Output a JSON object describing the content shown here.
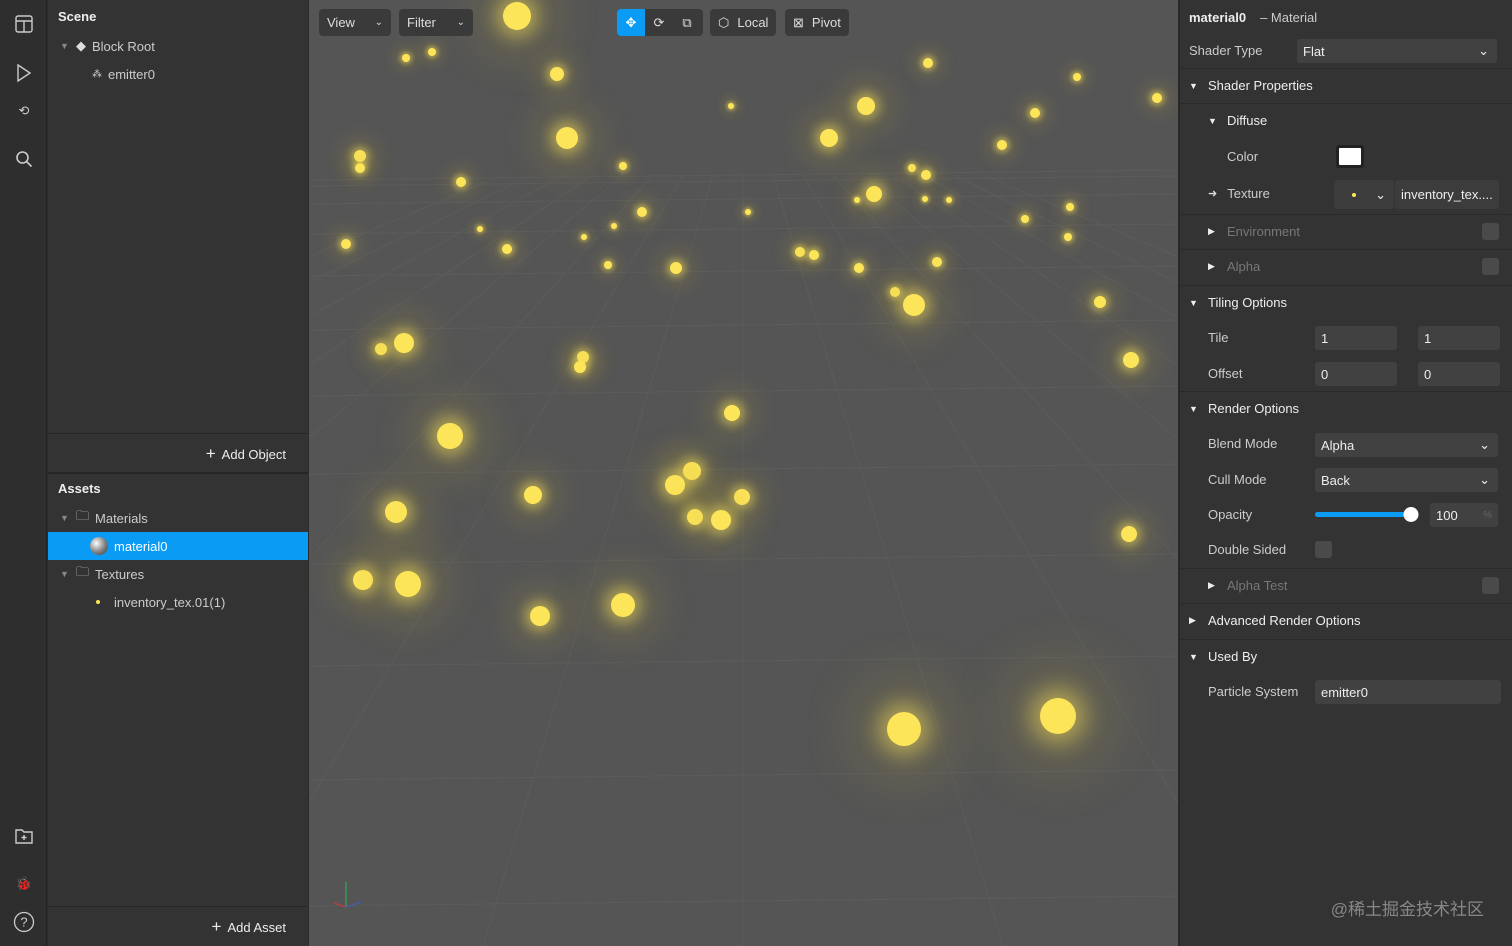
{
  "scene": {
    "title": "Scene",
    "items": [
      {
        "label": "Block Root"
      },
      {
        "label": "emitter0"
      }
    ],
    "add_label": "Add Object"
  },
  "assets": {
    "title": "Assets",
    "folders": [
      {
        "label": "Materials"
      },
      {
        "label": "material0"
      },
      {
        "label": "Textures"
      },
      {
        "label": "inventory_tex.01(1)"
      }
    ],
    "add_label": "Add Asset"
  },
  "toolbar": {
    "view": "View",
    "filter": "Filter",
    "local": "Local",
    "pivot": "Pivot"
  },
  "inspector": {
    "name": "material0",
    "type": "– Material",
    "shader_type_label": "Shader Type",
    "shader_type": "Flat",
    "shader_props": "Shader Properties",
    "diffuse": "Diffuse",
    "color_label": "Color",
    "color": "#ffffff",
    "texture_label": "Texture",
    "texture_value": "inventory_tex....",
    "environment": "Environment",
    "alpha": "Alpha",
    "tiling": "Tiling Options",
    "tile_label": "Tile",
    "tile_x": "1",
    "tile_y": "1",
    "offset_label": "Offset",
    "offset_x": "0",
    "offset_y": "0",
    "render": "Render Options",
    "blend_label": "Blend Mode",
    "blend": "Alpha",
    "cull_label": "Cull Mode",
    "cull": "Back",
    "opacity_label": "Opacity",
    "opacity": "100",
    "opacity_unit": "%",
    "opacity_fraction": 1.0,
    "double_sided": "Double Sided",
    "alpha_test": "Alpha Test",
    "advanced": "Advanced Render Options",
    "used_by": "Used By",
    "particle_label": "Particle System",
    "particle": "emitter0"
  },
  "colors": {
    "accent": "#0a9cf5",
    "particle": "#fde55a"
  },
  "watermark": "@稀土掘金技术社区"
}
